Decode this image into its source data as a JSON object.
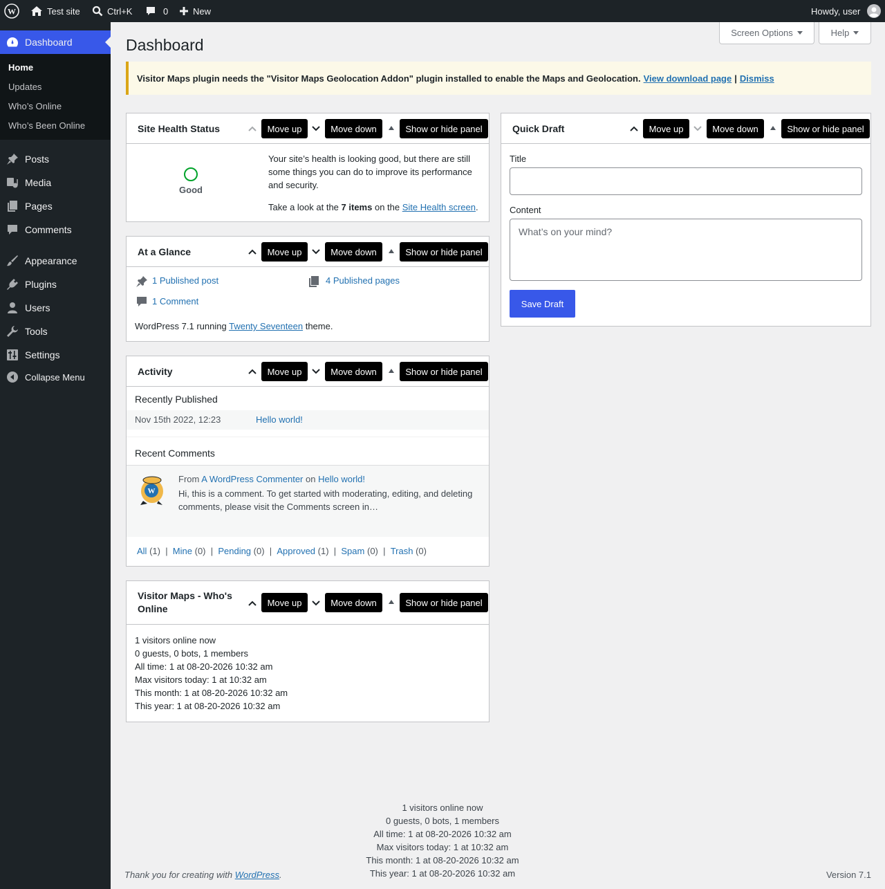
{
  "adminbar": {
    "site_name": "Test site",
    "search_shortcut": "Ctrl+K",
    "comments_count": "0",
    "new_label": "New",
    "howdy": "Howdy, user"
  },
  "sidebar": {
    "dashboard": "Dashboard",
    "submenu": [
      "Home",
      "Updates",
      "Who’s Online",
      "Who’s Been Online"
    ],
    "items": [
      "Posts",
      "Media",
      "Pages",
      "Comments",
      "Appearance",
      "Plugins",
      "Users",
      "Tools",
      "Settings"
    ],
    "collapse": "Collapse Menu"
  },
  "screen_options": "Screen Options",
  "help": "Help",
  "page_title": "Dashboard",
  "notice": {
    "text": "Visitor Maps plugin needs the \"Visitor Maps Geolocation Addon\" plugin installed to enable the Maps and Geolocation.",
    "link1": "View download page",
    "sep": "|",
    "link2": "Dismiss"
  },
  "panel_buttons": {
    "up": "Move up",
    "down": "Move down",
    "toggle": "Show or hide panel"
  },
  "site_health": {
    "title": "Site Health Status",
    "status": "Good",
    "desc": "Your site’s health is looking good, but there are still some things you can do to improve its performance and security.",
    "look_pre": "Take a look at the",
    "items": "7 items",
    "look_mid": "on the",
    "link": "Site Health screen",
    "look_post": "."
  },
  "at_a_glance": {
    "title": "At a Glance",
    "posts": "1 Published post",
    "pages": "4 Published pages",
    "comments": "1 Comment",
    "running_pre": "WordPress 7.1 running",
    "theme": "Twenty Seventeen",
    "running_post": "theme."
  },
  "activity": {
    "title": "Activity",
    "recently_published": "Recently Published",
    "pub_date": "Nov 15th 2022, 12:23",
    "pub_title": "Hello world!",
    "recent_comments": "Recent Comments",
    "from": "From",
    "commenter": "A WordPress Commenter",
    "on": "on",
    "comment_post": "Hello world!",
    "comment_text": "Hi, this is a comment. To get started with moderating, editing, and deleting comments, please visit the Comments screen in…",
    "filters": [
      {
        "label": "All",
        "count": "(1)"
      },
      {
        "label": "Mine",
        "count": "(0)"
      },
      {
        "label": "Pending",
        "count": "(0)"
      },
      {
        "label": "Approved",
        "count": "(1)"
      },
      {
        "label": "Spam",
        "count": "(0)"
      },
      {
        "label": "Trash",
        "count": "(0)"
      }
    ]
  },
  "visitor_maps": {
    "title_line1": "Visitor Maps - Who's",
    "title_line2": "Online",
    "lines": [
      "1 visitors online now",
      "0 guests, 0 bots, 1 members",
      "All time: 1 at 08-20-2026 10:32 am",
      "Max visitors today: 1 at 10:32 am",
      "This month: 1 at 08-20-2026 10:32 am",
      "This year: 1 at 08-20-2026 10:32 am"
    ]
  },
  "quick_draft": {
    "title": "Quick Draft",
    "title_label": "Title",
    "title_value": "",
    "content_label": "Content",
    "content_placeholder": "What’s on your mind?",
    "save": "Save Draft"
  },
  "footer": {
    "thanks_pre": "Thank you for creating with",
    "wp": "WordPress",
    "thanks_post": ".",
    "version": "Version 7.1",
    "stats": [
      "1 visitors online now",
      "0 guests, 0 bots, 1 members",
      "All time: 1 at 08-20-2026 10:32 am",
      "Max visitors today: 1 at 10:32 am",
      "This month: 1 at 08-20-2026 10:32 am",
      "This year: 1 at 08-20-2026 10:32 am"
    ]
  }
}
